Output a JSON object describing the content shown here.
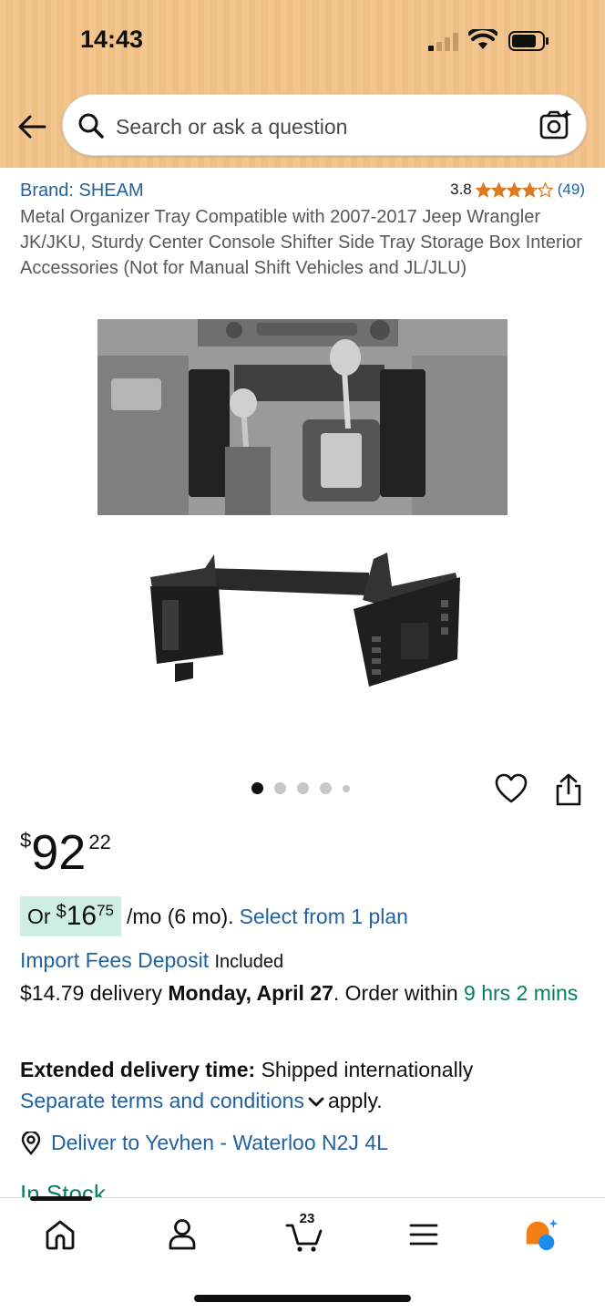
{
  "status_bar": {
    "time": "14:43"
  },
  "search": {
    "placeholder": "Search or ask a question"
  },
  "product": {
    "brand": "Brand: SHEAM",
    "rating_value": "3.8",
    "rating": 3.8,
    "rating_count": "(49)",
    "title": "Metal Organizer Tray Compatible with 2007-2017 Jeep Wrangler JK/JKU, Sturdy Center Console Shifter Side Tray Storage Box Interior Accessories (Not for Manual Shift Vehicles and JL/JLU)"
  },
  "gallery": {
    "image_count": 5,
    "active_index": 0
  },
  "price": {
    "symbol": "$",
    "whole": "92",
    "fraction": "22"
  },
  "installment": {
    "prefix": "Or",
    "symbol": "$",
    "whole": "16",
    "fraction": "75",
    "suffix": "/mo (6 mo).",
    "link": "Select from 1 plan"
  },
  "import_fees": {
    "link": "Import Fees Deposit",
    "status": "Included"
  },
  "delivery": {
    "cost": "$14.79 delivery",
    "date": "Monday, April 27",
    "order_within_prefix": ". Order within",
    "countdown": "9 hrs 2 mins"
  },
  "extended": {
    "label": "Extended delivery time:",
    "text": "Shipped internationally",
    "link": "Separate terms and conditions",
    "suffix": "apply."
  },
  "deliver_to": "Deliver to Yevhen - Waterloo N2J 4L",
  "stock": "In Stock",
  "tabbar": {
    "cart_count": "23"
  },
  "colors": {
    "link": "#2162a1",
    "green": "#067d62",
    "star": "#de7921",
    "header": "#f3c68f"
  }
}
